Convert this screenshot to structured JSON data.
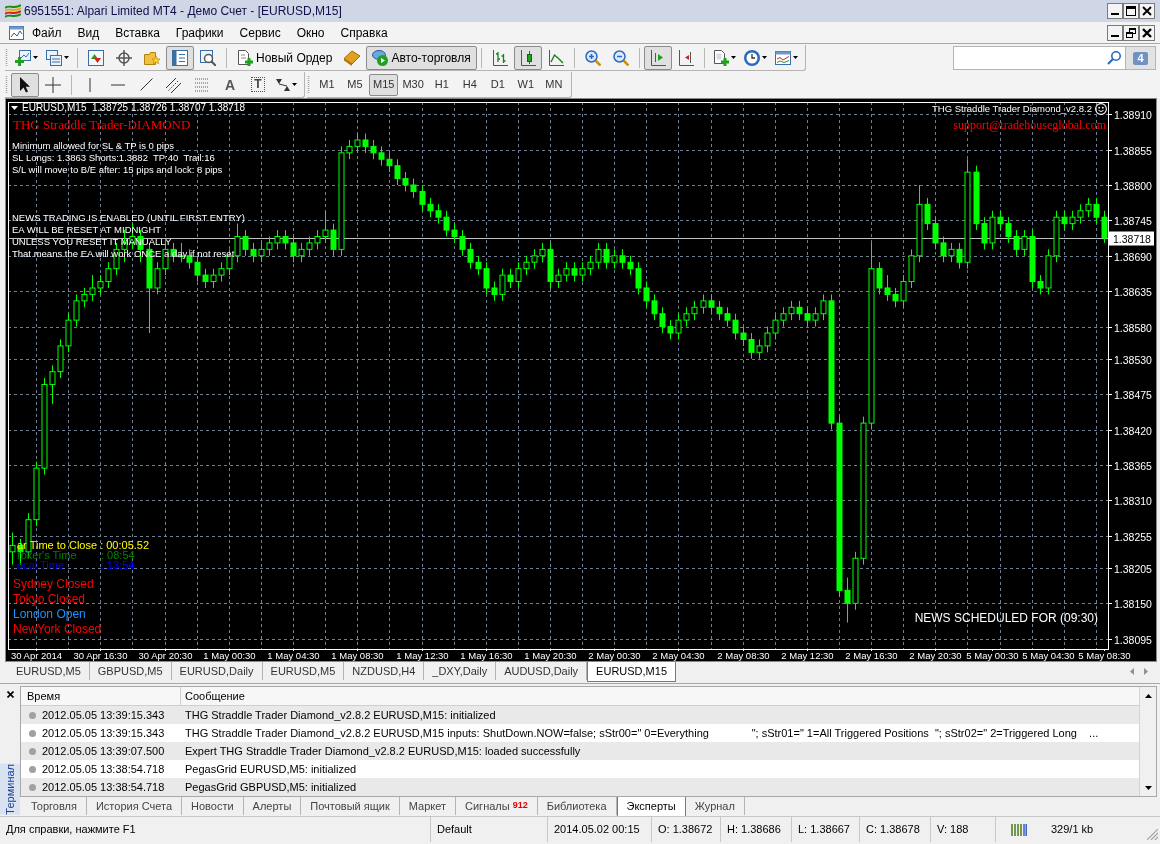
{
  "window": {
    "title": "6951551: Alpari Limited MT4 - Демо Счет - [EURUSD,M15]"
  },
  "menu": [
    "Файл",
    "Вид",
    "Вставка",
    "Графики",
    "Сервис",
    "Окно",
    "Справка"
  ],
  "toolbar": {
    "groups": [
      [
        {
          "kind": "new-chart",
          "on": false
        },
        {
          "kind": "profiles",
          "on": false
        }
      ],
      [
        {
          "kind": "market-watch",
          "on": false
        },
        {
          "kind": "data-window",
          "on": false
        },
        {
          "kind": "navigator",
          "on": false
        },
        {
          "kind": "terminal",
          "on": true
        },
        {
          "kind": "tester",
          "on": false
        }
      ],
      [
        {
          "kind": "new-order",
          "label": "Новый Ордер",
          "on": false
        },
        {
          "kind": "metaeditor",
          "on": false
        },
        {
          "kind": "autotrading",
          "label": "Авто-торговля",
          "on": true
        }
      ],
      [
        {
          "kind": "bar-chart",
          "on": false
        },
        {
          "kind": "candle-chart",
          "on": true
        },
        {
          "kind": "line-chart",
          "on": false
        }
      ],
      [
        {
          "kind": "zoom-in",
          "on": false
        },
        {
          "kind": "zoom-out",
          "on": false
        }
      ],
      [
        {
          "kind": "autoscroll",
          "on": true
        },
        {
          "kind": "chart-shift",
          "on": false
        }
      ],
      [
        {
          "kind": "indicators",
          "on": false
        },
        {
          "kind": "periods",
          "on": false
        },
        {
          "kind": "templates",
          "on": false
        }
      ]
    ]
  },
  "notifications": {
    "count": "4"
  },
  "drawing_toolbar": {
    "groups": [
      [
        {
          "kind": "cursor",
          "on": true
        },
        {
          "kind": "crosshair",
          "on": false
        }
      ],
      [
        {
          "kind": "vertical-line",
          "on": false
        },
        {
          "kind": "horizontal-line",
          "on": false
        },
        {
          "kind": "trendline",
          "on": false
        },
        {
          "kind": "channel",
          "on": false
        },
        {
          "kind": "fibonacci",
          "on": false
        },
        {
          "kind": "text",
          "glyph": "A",
          "on": false
        },
        {
          "kind": "text-label",
          "glyph": "T",
          "on": false
        },
        {
          "kind": "arrows",
          "on": false
        }
      ]
    ]
  },
  "timeframes": [
    {
      "label": "M1",
      "selected": false
    },
    {
      "label": "M5",
      "selected": false
    },
    {
      "label": "M15",
      "selected": true
    },
    {
      "label": "M30",
      "selected": false
    },
    {
      "label": "H1",
      "selected": false
    },
    {
      "label": "H4",
      "selected": false
    },
    {
      "label": "D1",
      "selected": false
    },
    {
      "label": "W1",
      "selected": false
    },
    {
      "label": "MN",
      "selected": false
    }
  ],
  "chart": {
    "symbol_line": "EURUSD,M15  1.38725 1.38726 1.38707 1.38718",
    "expert_name": "THG Straddle Trader Diamond_v2.8.2",
    "expert_title": "THG Straddle Trader-DIAMOND",
    "support_email": "support@tradehouseglobal.com",
    "settings_lines": [
      "Minimum allowed for SL & TP is 0 pips",
      "SL Longs: 1.3863 Shorts:1.3882  TP:40  Trail:16",
      "S/L will move to B/E after: 15 pips and lock: 8 pips"
    ],
    "notice_lines": [
      "NEWS TRADING IS ENABLED (UNTIL FIRST ENTRY)",
      "EA WILL BE RESET AT MIDNIGHT",
      "UNLESS YOU RESET IT MANUALLY",
      "That means the EA will work ONCE a day if not reset"
    ],
    "clock_lines": [
      {
        "text": "ar Time to Close : 00:05.52",
        "color": "#ffff00"
      },
      {
        "text": "roker's Time        : 08:54",
        "color": "#008000"
      },
      {
        "text": "ocal Time            : 13:54",
        "color": "#0000ff"
      }
    ],
    "sessions": [
      {
        "text": "Sydney Closed",
        "color": "#ff0000"
      },
      {
        "text": "Tokyo Closed",
        "color": "#ff0000"
      },
      {
        "text": "London Open",
        "color": "#1e90ff"
      },
      {
        "text": "NewYork Closed",
        "color": "#ff0000"
      }
    ],
    "news_scheduled": "NEWS SCHEDULED FOR (09:30)",
    "chart_data": [
      {
        "type": "candlestick",
        "color": "#00ff00",
        "categories": [
          null,
          null,
          null,
          "30 Apr 2014",
          null,
          null,
          null,
          null,
          null,
          null,
          null,
          "30 Apr 16:30",
          null,
          null,
          null,
          null,
          null,
          null,
          null,
          "30 Apr 20:30",
          null,
          null,
          null,
          null,
          null,
          null,
          null,
          "1 May 00:30",
          null,
          null,
          null,
          null,
          null,
          null,
          null,
          "1 May 04:30",
          null,
          null,
          null,
          null,
          null,
          null,
          null,
          "1 May 08:30",
          null,
          null,
          null,
          null,
          null,
          null,
          null,
          "1 May 12:30",
          null,
          null,
          null,
          null,
          null,
          null,
          null,
          "1 May 16:30",
          null,
          null,
          null,
          null,
          null,
          null,
          null,
          "1 May 20:30",
          null,
          null,
          null,
          null,
          null,
          null,
          null,
          "2 May 00:30",
          null,
          null,
          null,
          null,
          null,
          null,
          null,
          "2 May 04:30",
          null,
          null,
          null,
          null,
          null,
          null,
          null,
          "2 May 08:30",
          null,
          null,
          null,
          null,
          null,
          null,
          null,
          "2 May 12:30",
          null,
          null,
          null,
          null,
          null,
          null,
          null,
          "2 May 16:30",
          null,
          null,
          null,
          null,
          null,
          null,
          null,
          "2 May 20:30",
          null,
          null,
          null,
          null,
          null,
          null,
          "5 May 00:30",
          null,
          null,
          null,
          null,
          null,
          null,
          "5 May 04:30",
          null,
          null,
          null,
          null,
          null,
          null,
          "5 May 08:30"
        ],
        "ohlc": [
          [
            1.3823,
            1.3826,
            1.3821,
            1.3824
          ],
          [
            1.3824,
            1.3825,
            1.3821,
            1.3823
          ],
          [
            1.3823,
            1.3829,
            1.3822,
            1.3828
          ],
          [
            1.3828,
            1.3837,
            1.3827,
            1.3836
          ],
          [
            1.3836,
            1.385,
            1.3835,
            1.3849
          ],
          [
            1.3849,
            1.3852,
            1.3846,
            1.3851
          ],
          [
            1.3851,
            1.3856,
            1.385,
            1.3855
          ],
          [
            1.3855,
            1.386,
            1.3854,
            1.3859
          ],
          [
            1.3859,
            1.3863,
            1.3858,
            1.3862
          ],
          [
            1.3862,
            1.3864,
            1.3861,
            1.3863
          ],
          [
            1.3863,
            1.3866,
            1.3862,
            1.3864
          ],
          [
            1.3864,
            1.3866,
            1.3863,
            1.3865
          ],
          [
            1.3865,
            1.3868,
            1.3864,
            1.3867
          ],
          [
            1.3867,
            1.3871,
            1.3866,
            1.387
          ],
          [
            1.387,
            1.3873,
            1.3868,
            1.3871
          ],
          [
            1.3871,
            1.3874,
            1.387,
            1.3872
          ],
          [
            1.3872,
            1.3873,
            1.3868,
            1.387
          ],
          [
            1.387,
            1.3871,
            1.3857,
            1.3864
          ],
          [
            1.3864,
            1.3868,
            1.3863,
            1.3867
          ],
          [
            1.3867,
            1.3871,
            1.3866,
            1.387
          ],
          [
            1.387,
            1.3871,
            1.3868,
            1.3869
          ],
          [
            1.3869,
            1.3871,
            1.3868,
            1.3869
          ],
          [
            1.3869,
            1.387,
            1.3867,
            1.3868
          ],
          [
            1.3868,
            1.3869,
            1.3865,
            1.3866
          ],
          [
            1.3866,
            1.3867,
            1.3864,
            1.3865
          ],
          [
            1.3865,
            1.3867,
            1.3864,
            1.3866
          ],
          [
            1.3866,
            1.3868,
            1.3865,
            1.3867
          ],
          [
            1.3867,
            1.387,
            1.3866,
            1.3869
          ],
          [
            1.3869,
            1.3874,
            1.3868,
            1.3872
          ],
          [
            1.3872,
            1.3873,
            1.3869,
            1.387
          ],
          [
            1.387,
            1.3871,
            1.3868,
            1.3869
          ],
          [
            1.3869,
            1.3871,
            1.3868,
            1.387
          ],
          [
            1.387,
            1.3872,
            1.3869,
            1.3871
          ],
          [
            1.3871,
            1.3873,
            1.387,
            1.3872
          ],
          [
            1.3872,
            1.3873,
            1.387,
            1.3871
          ],
          [
            1.3871,
            1.3872,
            1.3868,
            1.3869
          ],
          [
            1.3869,
            1.3871,
            1.3868,
            1.387
          ],
          [
            1.387,
            1.3872,
            1.3869,
            1.3871
          ],
          [
            1.3871,
            1.3873,
            1.387,
            1.3872
          ],
          [
            1.3872,
            1.3876,
            1.3871,
            1.3873
          ],
          [
            1.3873,
            1.3874,
            1.3869,
            1.387
          ],
          [
            1.387,
            1.3886,
            1.3869,
            1.3885
          ],
          [
            1.3885,
            1.3887,
            1.3884,
            1.3886
          ],
          [
            1.3886,
            1.3888,
            1.3885,
            1.3887
          ],
          [
            1.3887,
            1.3888,
            1.3885,
            1.3886
          ],
          [
            1.3886,
            1.3887,
            1.3884,
            1.3885
          ],
          [
            1.3885,
            1.3886,
            1.3883,
            1.3884
          ],
          [
            1.3884,
            1.3885,
            1.3882,
            1.3883
          ],
          [
            1.3883,
            1.3884,
            1.388,
            1.3881
          ],
          [
            1.3881,
            1.3882,
            1.3879,
            1.388
          ],
          [
            1.388,
            1.3881,
            1.3878,
            1.3879
          ],
          [
            1.3879,
            1.388,
            1.3876,
            1.3877
          ],
          [
            1.3877,
            1.3878,
            1.3875,
            1.3876
          ],
          [
            1.3876,
            1.3877,
            1.3874,
            1.3875
          ],
          [
            1.3875,
            1.3876,
            1.3872,
            1.3873
          ],
          [
            1.3873,
            1.3874,
            1.3871,
            1.3872
          ],
          [
            1.3872,
            1.3873,
            1.3869,
            1.387
          ],
          [
            1.387,
            1.3871,
            1.3867,
            1.3868
          ],
          [
            1.3868,
            1.3869,
            1.3866,
            1.3867
          ],
          [
            1.3867,
            1.3868,
            1.3863,
            1.3864
          ],
          [
            1.3864,
            1.3865,
            1.3862,
            1.3863
          ],
          [
            1.3863,
            1.3867,
            1.3862,
            1.3866
          ],
          [
            1.3866,
            1.3867,
            1.3864,
            1.3865
          ],
          [
            1.3865,
            1.3868,
            1.3864,
            1.3867
          ],
          [
            1.3867,
            1.3869,
            1.3866,
            1.3868
          ],
          [
            1.3868,
            1.387,
            1.3867,
            1.3869
          ],
          [
            1.3869,
            1.3871,
            1.3868,
            1.387
          ],
          [
            1.387,
            1.3871,
            1.3864,
            1.3865
          ],
          [
            1.3865,
            1.3867,
            1.3864,
            1.3866
          ],
          [
            1.3866,
            1.3868,
            1.3865,
            1.3867
          ],
          [
            1.3867,
            1.3868,
            1.3865,
            1.3866
          ],
          [
            1.3866,
            1.3868,
            1.3865,
            1.3867
          ],
          [
            1.3867,
            1.3869,
            1.3866,
            1.3868
          ],
          [
            1.3868,
            1.3871,
            1.3867,
            1.387
          ],
          [
            1.387,
            1.3871,
            1.3867,
            1.3868
          ],
          [
            1.3868,
            1.387,
            1.3867,
            1.3869
          ],
          [
            1.3869,
            1.387,
            1.3867,
            1.3868
          ],
          [
            1.3868,
            1.3869,
            1.3866,
            1.3867
          ],
          [
            1.3867,
            1.3868,
            1.3863,
            1.3864
          ],
          [
            1.3864,
            1.3865,
            1.3861,
            1.3862
          ],
          [
            1.3862,
            1.3863,
            1.3859,
            1.386
          ],
          [
            1.386,
            1.3861,
            1.3857,
            1.3858
          ],
          [
            1.3858,
            1.3859,
            1.3856,
            1.3857
          ],
          [
            1.3857,
            1.386,
            1.3856,
            1.3859
          ],
          [
            1.3859,
            1.3861,
            1.3858,
            1.386
          ],
          [
            1.386,
            1.3862,
            1.3859,
            1.3861
          ],
          [
            1.3861,
            1.3863,
            1.386,
            1.3862
          ],
          [
            1.3862,
            1.3863,
            1.386,
            1.3861
          ],
          [
            1.3861,
            1.3862,
            1.3859,
            1.386
          ],
          [
            1.386,
            1.3861,
            1.3858,
            1.3859
          ],
          [
            1.3859,
            1.386,
            1.3856,
            1.3857
          ],
          [
            1.3857,
            1.3858,
            1.3855,
            1.3856
          ],
          [
            1.3856,
            1.3857,
            1.3853,
            1.3854
          ],
          [
            1.3854,
            1.3856,
            1.3853,
            1.3855
          ],
          [
            1.3855,
            1.3858,
            1.3854,
            1.3857
          ],
          [
            1.3857,
            1.386,
            1.3856,
            1.3859
          ],
          [
            1.3859,
            1.3861,
            1.3858,
            1.386
          ],
          [
            1.386,
            1.3862,
            1.3859,
            1.3861
          ],
          [
            1.3861,
            1.3862,
            1.3859,
            1.386
          ],
          [
            1.386,
            1.3861,
            1.3858,
            1.3859
          ],
          [
            1.3859,
            1.3861,
            1.3858,
            1.386
          ],
          [
            1.386,
            1.3863,
            1.3859,
            1.3862
          ],
          [
            1.3862,
            1.3863,
            1.3842,
            1.3843
          ],
          [
            1.3843,
            1.3844,
            1.3816,
            1.3817
          ],
          [
            1.3817,
            1.3819,
            1.3812,
            1.3815
          ],
          [
            1.3815,
            1.3823,
            1.3814,
            1.3822
          ],
          [
            1.3822,
            1.3844,
            1.3821,
            1.3843
          ],
          [
            1.3843,
            1.3871,
            1.3842,
            1.3867
          ],
          [
            1.3867,
            1.3868,
            1.3863,
            1.3864
          ],
          [
            1.3864,
            1.3866,
            1.3862,
            1.3863
          ],
          [
            1.3863,
            1.3864,
            1.3861,
            1.3862
          ],
          [
            1.3862,
            1.3866,
            1.3861,
            1.3865
          ],
          [
            1.3865,
            1.387,
            1.3864,
            1.3869
          ],
          [
            1.3869,
            1.388,
            1.3868,
            1.3877
          ],
          [
            1.3877,
            1.3878,
            1.3873,
            1.3874
          ],
          [
            1.3874,
            1.3875,
            1.387,
            1.3871
          ],
          [
            1.3871,
            1.3872,
            1.3868,
            1.3869
          ],
          [
            1.3869,
            1.3871,
            1.3868,
            1.387
          ],
          [
            1.387,
            1.3871,
            1.3867,
            1.3868
          ],
          [
            1.3868,
            1.3884,
            1.3867,
            1.3882
          ],
          [
            1.3882,
            1.3883,
            1.3873,
            1.3874
          ],
          [
            1.3874,
            1.3875,
            1.387,
            1.3871
          ],
          [
            1.3871,
            1.3876,
            1.387,
            1.3875
          ],
          [
            1.3875,
            1.3876,
            1.3873,
            1.3874
          ],
          [
            1.3874,
            1.3875,
            1.3871,
            1.3872
          ],
          [
            1.3872,
            1.3873,
            1.3869,
            1.387
          ],
          [
            1.387,
            1.3873,
            1.3869,
            1.3872
          ],
          [
            1.3872,
            1.3873,
            1.3864,
            1.3865
          ],
          [
            1.3865,
            1.3866,
            1.3863,
            1.3864
          ],
          [
            1.3864,
            1.387,
            1.3863,
            1.3869
          ],
          [
            1.3869,
            1.3876,
            1.3868,
            1.3875
          ],
          [
            1.3875,
            1.3876,
            1.3873,
            1.3874
          ],
          [
            1.3874,
            1.3876,
            1.3873,
            1.3875
          ],
          [
            1.3875,
            1.3877,
            1.3874,
            1.3876
          ],
          [
            1.3876,
            1.3878,
            1.3875,
            1.3877
          ],
          [
            1.3877,
            1.3878,
            1.3874,
            1.3875
          ],
          [
            1.3875,
            1.3876,
            1.3871,
            1.38718
          ]
        ],
        "ylim": [
          1.38079,
          1.38929
        ],
        "yticks": [
          {
            "value": 1.3891,
            "label": "1.38910"
          },
          {
            "value": 1.38855,
            "label": "1.38855"
          },
          {
            "value": 1.388,
            "label": "1.38800"
          },
          {
            "value": 1.38745,
            "label": "1.38745"
          },
          {
            "value": 1.3869,
            "label": "1.38690"
          },
          {
            "value": 1.38635,
            "label": "1.38635"
          },
          {
            "value": 1.3858,
            "label": "1.38580"
          },
          {
            "value": 1.3853,
            "label": "1.38530"
          },
          {
            "value": 1.38475,
            "label": "1.38475"
          },
          {
            "value": 1.3842,
            "label": "1.38420"
          },
          {
            "value": 1.38365,
            "label": "1.38365"
          },
          {
            "value": 1.3831,
            "label": "1.38310"
          },
          {
            "value": 1.38255,
            "label": "1.38255"
          },
          {
            "value": 1.38205,
            "label": "1.38205"
          },
          {
            "value": 1.3815,
            "label": "1.38150"
          },
          {
            "value": 1.38095,
            "label": "1.38095"
          }
        ],
        "grid": true,
        "ref_lines": [
          {
            "axis": "y",
            "value": 1.38718,
            "label": "1.38718",
            "color": "#c0c0c0"
          }
        ]
      }
    ]
  },
  "chart_tabs": [
    {
      "label": "EURUSD,M5",
      "selected": false
    },
    {
      "label": "GBPUSD,M5",
      "selected": false
    },
    {
      "label": "EURUSD,Daily",
      "selected": false
    },
    {
      "label": "EURUSD,M5",
      "selected": false
    },
    {
      "label": "NZDUSD,H4",
      "selected": false
    },
    {
      "label": "_DXY,Daily",
      "selected": false
    },
    {
      "label": "AUDUSD,Daily",
      "selected": false
    },
    {
      "label": "EURUSD,M15",
      "selected": true
    }
  ],
  "terminal": {
    "title": "Терминал",
    "columns": [
      "Время",
      "Сообщение"
    ],
    "rows": [
      {
        "time": "2012.05.05 13:39:15.343",
        "message": "THG Straddle Trader Diamond_v2.8.2 EURUSD,M15: initialized",
        "selected": false
      },
      {
        "time": "2012.05.05 13:39:15.343",
        "message": "THG Straddle Trader Diamond_v2.8.2 EURUSD,M15 inputs: ShutDown.NOW=false; sStr00=\" 0=Everything              \"; sStr01=\" 1=All Triggered Positions  \"; sStr02=\" 2=Triggered Long    ...",
        "selected": false
      },
      {
        "time": "2012.05.05 13:39:07.500",
        "message": "Expert THG Straddle Trader Diamond_v2.8.2 EURUSD,M15: loaded successfully",
        "selected": false
      },
      {
        "time": "2012.05.05 13:38:54.718",
        "message": "PegasGrid EURUSD,M5: initialized",
        "selected": false
      },
      {
        "time": "2012.05.05 13:38:54.718",
        "message": "PegasGrid GBPUSD,M5: initialized",
        "selected": false
      }
    ],
    "tabs": [
      {
        "label": "Торговля",
        "selected": false
      },
      {
        "label": "История Счета",
        "selected": false
      },
      {
        "label": "Новости",
        "selected": false
      },
      {
        "label": "Алерты",
        "selected": false
      },
      {
        "label": "Почтовый ящик",
        "selected": false
      },
      {
        "label": "Маркет",
        "selected": false
      },
      {
        "label": "Сигналы",
        "badge": "912",
        "selected": false
      },
      {
        "label": "Библиотека",
        "selected": false
      },
      {
        "label": "Эксперты",
        "selected": true
      },
      {
        "label": "Журнал",
        "selected": false
      }
    ]
  },
  "status_bar": {
    "help": "Для справки, нажмите F1",
    "profile": "Default",
    "bar_time": "2014.05.02 00:15",
    "open": "O: 1.38672",
    "high": "H: 1.38686",
    "low": "L: 1.38667",
    "close": "C: 1.38678",
    "volume": "V: 188",
    "traffic": "329/1 kb"
  }
}
